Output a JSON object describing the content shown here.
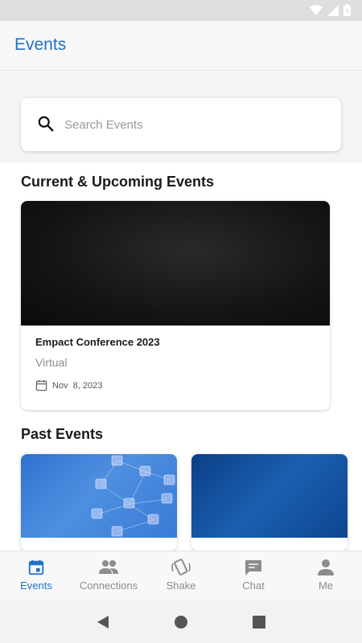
{
  "app": {
    "title": "Events"
  },
  "search": {
    "placeholder": "Search Events",
    "value": ""
  },
  "sections": {
    "current_title": "Current & Upcoming Events",
    "past_title": "Past Events"
  },
  "current_events": [
    {
      "name": "Empact Conference 2023",
      "location": "Virtual",
      "date": "Nov  8, 2023"
    }
  ],
  "nav": {
    "items": [
      {
        "label": "Events",
        "icon": "calendar-icon",
        "active": true
      },
      {
        "label": "Connections",
        "icon": "people-icon",
        "active": false
      },
      {
        "label": "Shake",
        "icon": "shake-phone-icon",
        "active": false
      },
      {
        "label": "Chat",
        "icon": "chat-bubble-icon",
        "active": false
      },
      {
        "label": "Me",
        "icon": "person-icon",
        "active": false
      }
    ]
  },
  "colors": {
    "accent": "#1f72c8",
    "nav_inactive": "#8c8c8c",
    "past_event_1": "#3a7bd6",
    "past_event_2": "#0e4590"
  }
}
